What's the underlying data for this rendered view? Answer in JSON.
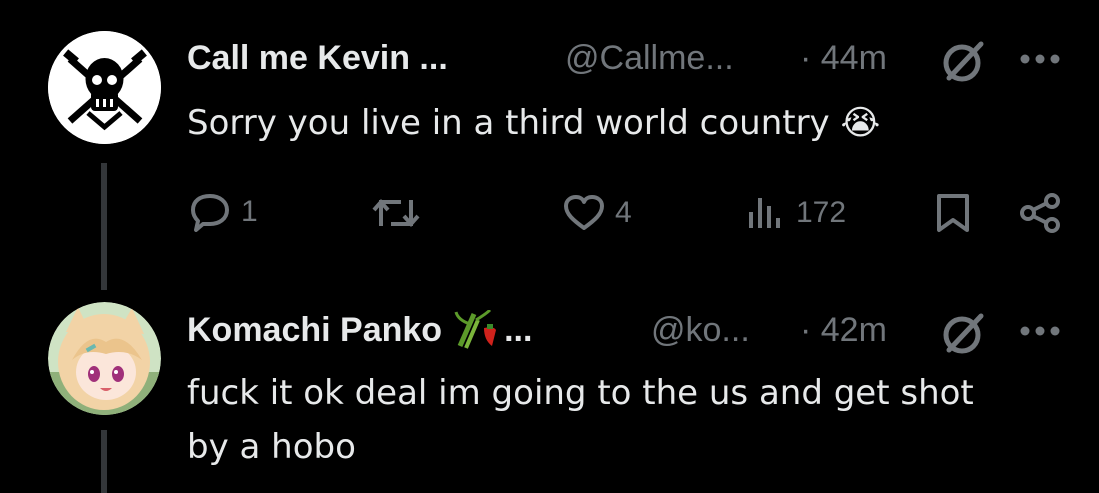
{
  "tweets": [
    {
      "display_name": "Call me Kevin ...",
      "handle": "@Callme...",
      "time": "· 44m",
      "text": "Sorry you live in a third world country",
      "emoji": "😭",
      "actions": {
        "reply_count": "1",
        "retweet_count": "",
        "like_count": "4",
        "views_count": "172"
      }
    },
    {
      "display_name": "Komachi Panko",
      "name_suffix": "...",
      "handle": "@ko...",
      "time": "· 42m",
      "text_line1": "fuck it ok deal im going to the us and get shot",
      "text_line2": "by a hobo"
    }
  ],
  "icons": {
    "reply": "reply-icon",
    "retweet": "retweet-icon",
    "like": "heart-icon",
    "views": "views-icon",
    "bookmark": "bookmark-icon",
    "share": "share-icon",
    "more": "more-icon",
    "verified": "verified-badge-icon"
  },
  "colors": {
    "background": "#000000",
    "primary_text": "#e7e9ea",
    "secondary_text": "#71767b",
    "thread_line": "#333639"
  }
}
